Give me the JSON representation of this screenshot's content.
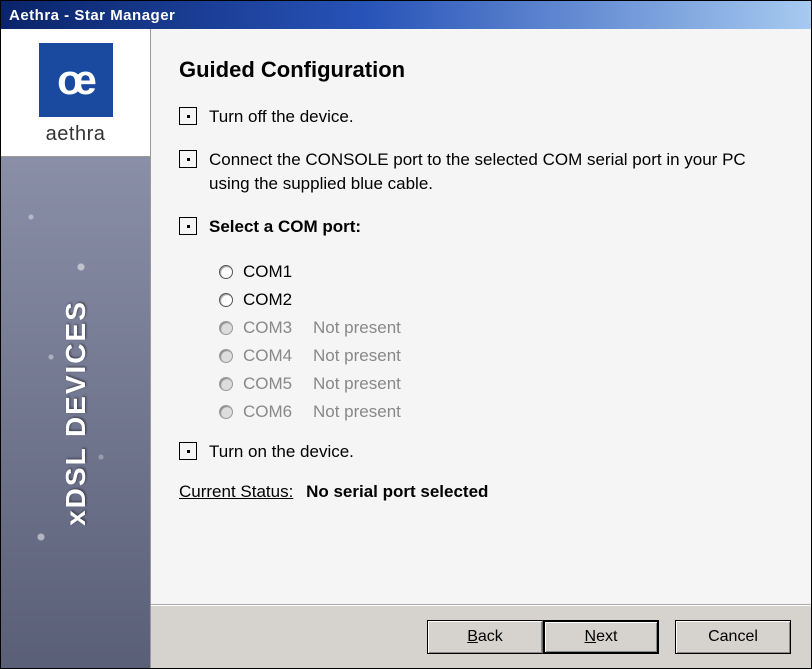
{
  "window": {
    "title": "Aethra - Star Manager"
  },
  "sidebar": {
    "logo_glyph": "œ",
    "logo_text": "aethra",
    "banner_text": "xDSL DEVICES"
  },
  "page": {
    "title": "Guided Configuration",
    "steps": [
      {
        "text": "Turn off the device.",
        "bold": false
      },
      {
        "text": "Connect the CONSOLE port to the selected COM serial port in your PC using the supplied blue cable.",
        "bold": false
      },
      {
        "text": "Select a COM port:",
        "bold": true
      },
      {
        "text": "Turn on the device.",
        "bold": false
      }
    ],
    "com_ports": [
      {
        "label": "COM1",
        "enabled": true,
        "note": ""
      },
      {
        "label": "COM2",
        "enabled": true,
        "note": ""
      },
      {
        "label": "COM3",
        "enabled": false,
        "note": "Not present"
      },
      {
        "label": "COM4",
        "enabled": false,
        "note": "Not present"
      },
      {
        "label": "COM5",
        "enabled": false,
        "note": "Not present"
      },
      {
        "label": "COM6",
        "enabled": false,
        "note": "Not present"
      }
    ],
    "status_label": "Current Status:",
    "status_value": "No serial port selected"
  },
  "buttons": {
    "back_prefix": "B",
    "back_rest": "ack",
    "next_prefix": "N",
    "next_rest": "ext",
    "cancel": "Cancel"
  }
}
